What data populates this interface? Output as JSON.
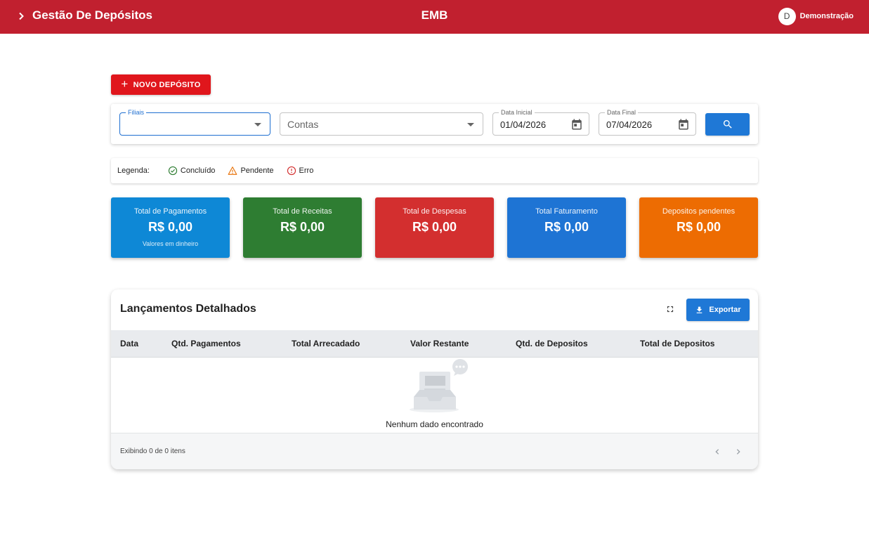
{
  "header": {
    "title": "Gestão De Depósitos",
    "company": "EMB",
    "user_initial": "D",
    "user_name": "Demonstração",
    "bg_color": "#c1202f"
  },
  "actions": {
    "new_deposit_label": "NOVO DEPÓSITO"
  },
  "filters": {
    "filiais": {
      "label": "Filiais",
      "value": ""
    },
    "contas": {
      "placeholder": "Contas",
      "value": ""
    },
    "data_inicial": {
      "label": "Data Inicial",
      "value": "01/04/2026"
    },
    "data_final": {
      "label": "Data Final",
      "value": "07/04/2026"
    },
    "search_icon": "search-icon"
  },
  "legend": {
    "title": "Legenda:",
    "items": [
      {
        "label": "Concluído",
        "icon": "check-circle-icon",
        "color": "#2e7d32"
      },
      {
        "label": "Pendente",
        "icon": "warning-icon",
        "color": "#e8740c"
      },
      {
        "label": "Erro",
        "icon": "error-icon",
        "color": "#d32f2f"
      }
    ]
  },
  "summary": [
    {
      "label": "Total de Pagamentos",
      "value": "R$ 0,00",
      "sub": "Valores em dinheiro",
      "color": "#0e88d6"
    },
    {
      "label": "Total de Receitas",
      "value": "R$ 0,00",
      "sub": "",
      "color": "#2e7d32"
    },
    {
      "label": "Total de Despesas",
      "value": "R$ 0,00",
      "sub": "",
      "color": "#d32f2f"
    },
    {
      "label": "Total Faturamento",
      "value": "R$ 0,00",
      "sub": "",
      "color": "#1e74d4"
    },
    {
      "label": "Depositos pendentes",
      "value": "R$ 0,00",
      "sub": "",
      "color": "#ed6c02"
    }
  ],
  "table": {
    "title": "Lançamentos Detalhados",
    "export_label": "Exportar",
    "columns": [
      "Data",
      "Qtd. Pagamentos",
      "Total Arrecadado",
      "Valor Restante",
      "Qtd. de Depositos",
      "Total de Depositos"
    ],
    "rows": [],
    "empty_message": "Nenhum dado encontrado",
    "footer_count": "Exibindo 0 de 0 itens"
  }
}
